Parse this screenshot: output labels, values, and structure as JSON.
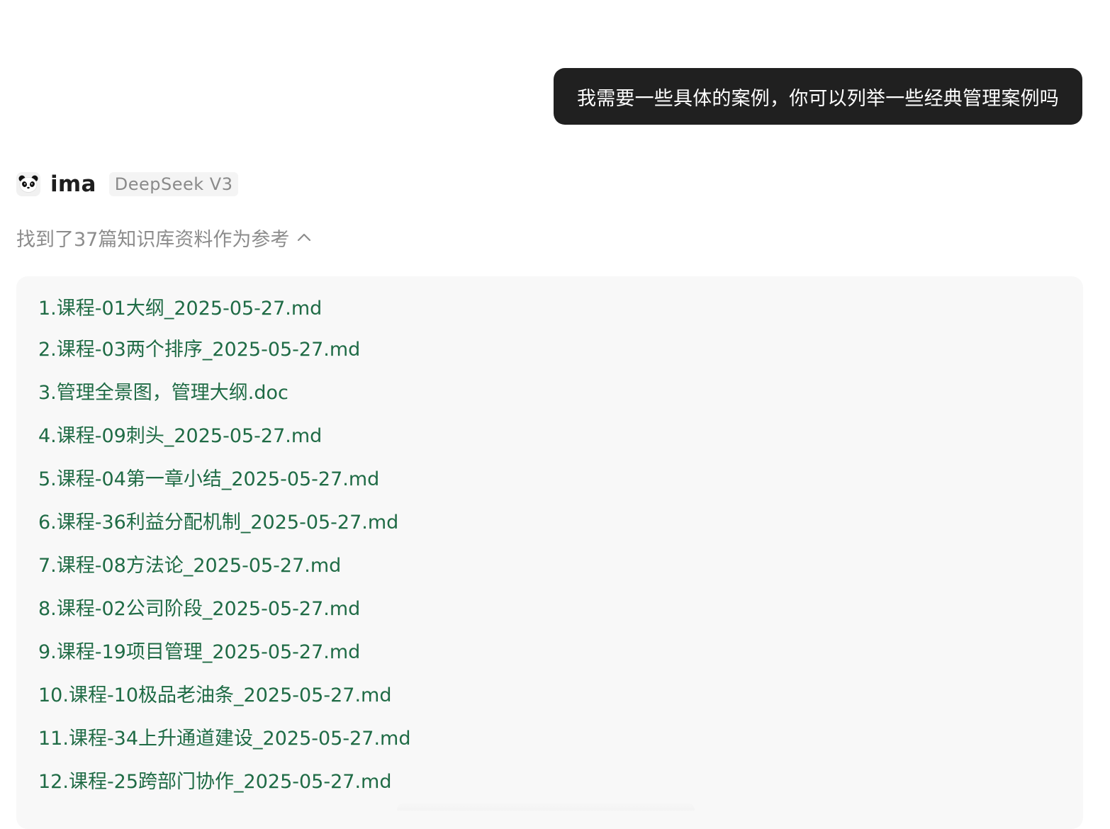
{
  "user_message": {
    "text": "我需要一些具体的案例，你可以列举一些经典管理案例吗"
  },
  "assistant": {
    "avatar_icon": "panda-icon",
    "name": "ima",
    "model_badge": "DeepSeek V3"
  },
  "references": {
    "summary": "找到了37篇知识库资料作为参考",
    "expanded": true,
    "toggle_icon": "chevron-up-icon",
    "items": [
      {
        "label": "1.课程-01大纲_2025-05-27.md"
      },
      {
        "label": "2.课程-03两个排序_2025-05-27.md"
      },
      {
        "label": "3.管理全景图，管理大纲.doc"
      },
      {
        "label": "4.课程-09刺头_2025-05-27.md"
      },
      {
        "label": "5.课程-04第一章小结_2025-05-27.md"
      },
      {
        "label": "6.课程-36利益分配机制_2025-05-27.md"
      },
      {
        "label": "7.课程-08方法论_2025-05-27.md"
      },
      {
        "label": "8.课程-02公司阶段_2025-05-27.md"
      },
      {
        "label": "9.课程-19项目管理_2025-05-27.md"
      },
      {
        "label": "10.课程-10极品老油条_2025-05-27.md"
      },
      {
        "label": "11.课程-34上升通道建设_2025-05-27.md"
      },
      {
        "label": "12.课程-25跨部门协作_2025-05-27.md"
      }
    ]
  },
  "colors": {
    "bubble_bg": "#202020",
    "link_green": "#1f6b45",
    "muted_text": "#8c8c8c",
    "card_bg": "#f8f8f8"
  }
}
